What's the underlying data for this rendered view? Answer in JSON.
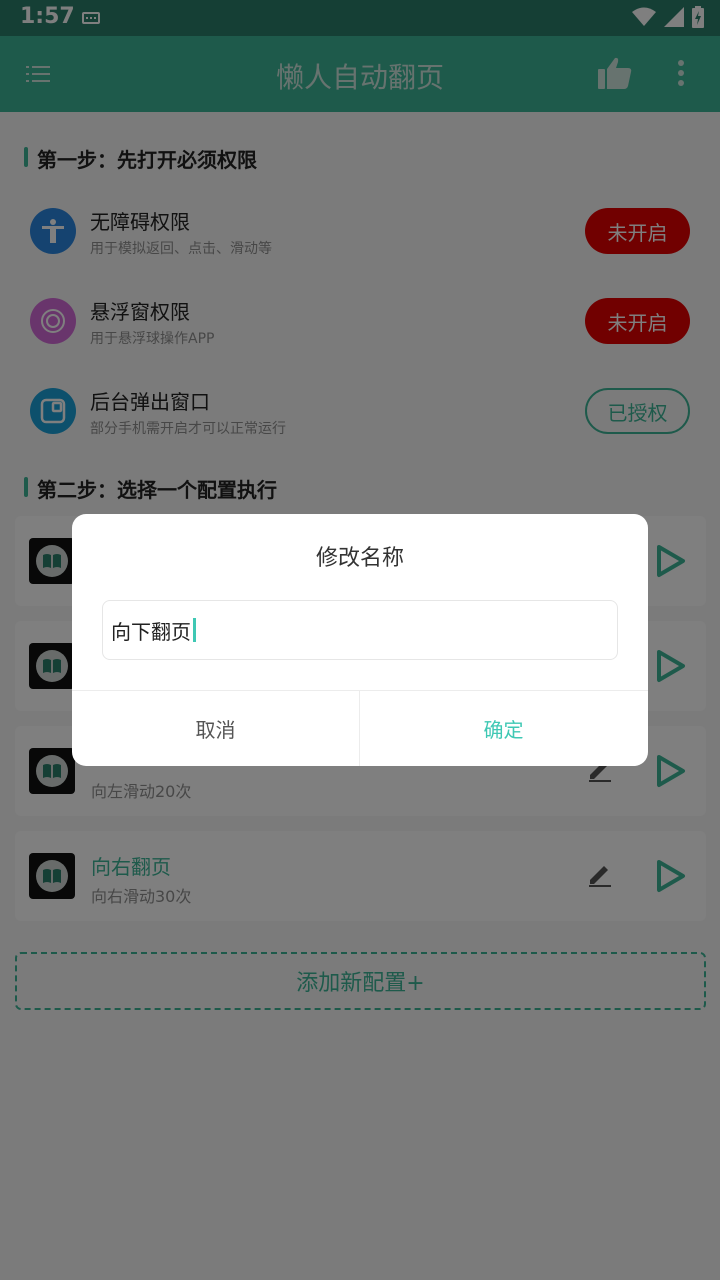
{
  "status": {
    "time": "1:57"
  },
  "appbar": {
    "title": "懒人自动翻页"
  },
  "step1": {
    "title": "第一步：先打开必须权限",
    "items": [
      {
        "title": "无障碍权限",
        "subtitle": "用于模拟返回、点击、滑动等",
        "status": "未开启",
        "icon": "accessibility-icon",
        "color": "#2a86e0"
      },
      {
        "title": "悬浮窗权限",
        "subtitle": "用于悬浮球操作APP",
        "status": "未开启",
        "icon": "floating-window-icon",
        "color": "#d36ad8"
      },
      {
        "title": "后台弹出窗口",
        "subtitle": "部分手机需开启才可以正常运行",
        "status": "已授权",
        "icon": "background-popup-icon",
        "color": "#1aa0d8"
      }
    ]
  },
  "step2": {
    "title": "第二步：选择一个配置执行",
    "configs": [
      {
        "title": "",
        "subtitle": ""
      },
      {
        "title": "",
        "subtitle": ""
      },
      {
        "title": "",
        "subtitle": "向左滑动20次"
      },
      {
        "title": "向右翻页",
        "subtitle": "向右滑动30次"
      }
    ],
    "add_label": "添加新配置+"
  },
  "dialog": {
    "title": "修改名称",
    "input_value": "向下翻页",
    "cancel_label": "取消",
    "ok_label": "确定"
  },
  "colors": {
    "primary": "#3db597",
    "status_bar": "#2b7f6a",
    "danger": "#e20000",
    "accent": "#3fc8b4"
  }
}
